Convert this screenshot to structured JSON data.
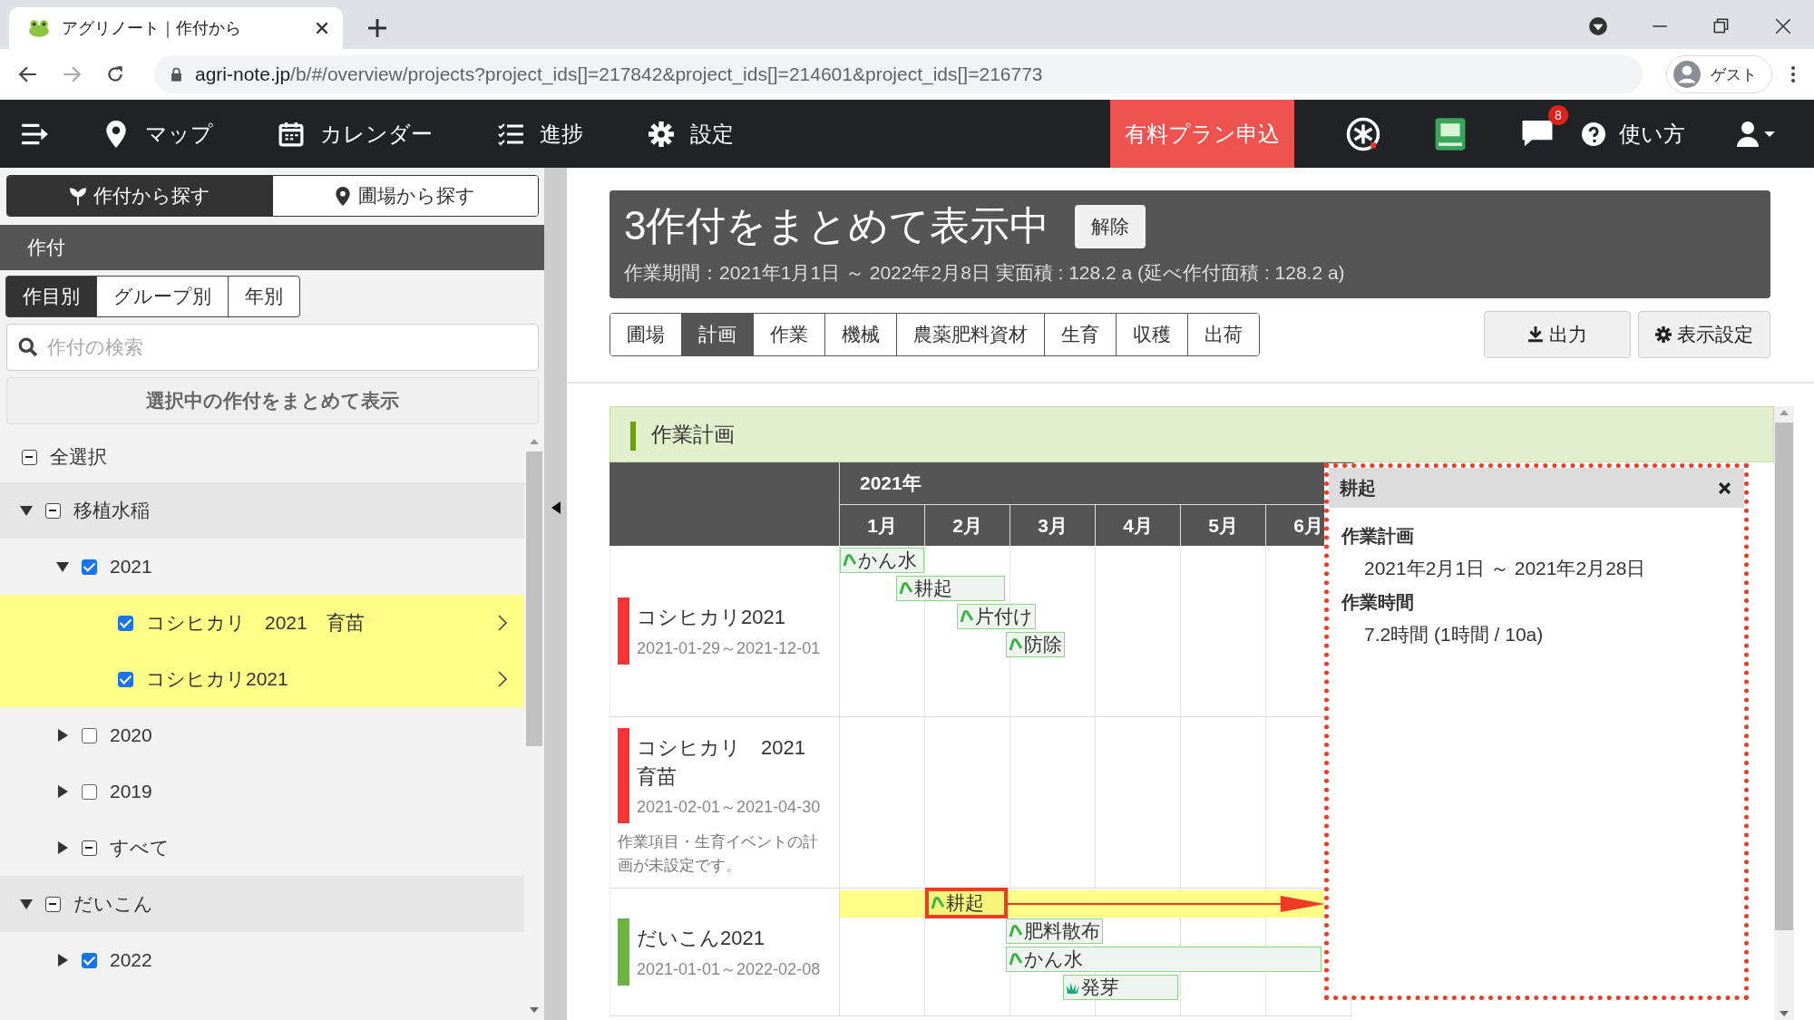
{
  "browser": {
    "tab_title": "アグリノート｜作付から",
    "url_host": "agri-note.jp",
    "url_path": "/b/#/overview/projects?project_ids[]=217842&project_ids[]=214601&project_ids[]=216773",
    "profile": "ゲスト"
  },
  "nav": {
    "items": [
      {
        "kind": "map",
        "label": "マップ"
      },
      {
        "kind": "calendar",
        "label": "カレンダー"
      },
      {
        "kind": "progress",
        "label": "進捗"
      },
      {
        "kind": "settings",
        "label": "設定"
      }
    ],
    "plan_button": "有料プラン申込",
    "notification_count": "8",
    "help_label": "使い方"
  },
  "sidebar": {
    "search_modes": [
      {
        "kind": "crop",
        "label": "作付から探す",
        "selected": true
      },
      {
        "kind": "field",
        "label": "圃場から探す",
        "selected": false
      }
    ],
    "section_title": "作付",
    "view_tabs": [
      {
        "label": "作目別",
        "selected": true
      },
      {
        "label": "グループ別",
        "selected": false
      },
      {
        "label": "年別",
        "selected": false
      }
    ],
    "search_placeholder": "作付の検索",
    "summarize_button": "選択中の作付をまとめて表示",
    "select_all": {
      "label": "全選択",
      "checked": true,
      "mixed": true
    },
    "tree": [
      {
        "kind": "group",
        "label": "移植水稲",
        "expanded": true,
        "checked": true,
        "mixed": true,
        "children": [
          {
            "kind": "year",
            "label": "2021",
            "expanded": true,
            "checked": true,
            "mixed": false,
            "children": [
              {
                "kind": "crop",
                "label": "コシヒカリ　2021　育苗",
                "checked": true,
                "mixed": false,
                "selected": true
              },
              {
                "kind": "crop",
                "label": "コシヒカリ2021",
                "checked": true,
                "mixed": false,
                "selected": true
              }
            ]
          },
          {
            "kind": "year",
            "label": "2020",
            "expanded": false,
            "checked": false,
            "mixed": false
          },
          {
            "kind": "year",
            "label": "2019",
            "expanded": false,
            "checked": false,
            "mixed": false
          },
          {
            "kind": "year",
            "label": "すべて",
            "expanded": false,
            "checked": true,
            "mixed": true
          }
        ]
      },
      {
        "kind": "group",
        "label": "だいこん",
        "expanded": true,
        "checked": true,
        "mixed": true,
        "children": [
          {
            "kind": "year",
            "label": "2022",
            "expanded": false,
            "checked": true,
            "mixed": false
          }
        ]
      }
    ]
  },
  "header": {
    "title": "3作付をまとめて表示中",
    "release_button": "解除",
    "summary": "作業期間：2021年1月1日 ～ 2022年2月8日  実面積 : 128.2 a (延べ作付面積 : 128.2 a)"
  },
  "tabs": [
    {
      "label": "圃場",
      "selected": false
    },
    {
      "label": "計画",
      "selected": true
    },
    {
      "label": "作業",
      "selected": false
    },
    {
      "label": "機械",
      "selected": false
    },
    {
      "label": "農薬肥料資材",
      "selected": false
    },
    {
      "label": "生育",
      "selected": false
    },
    {
      "label": "収穫",
      "selected": false
    },
    {
      "label": "出荷",
      "selected": false
    }
  ],
  "export_button": "出力",
  "display_settings_button": "表示設定",
  "plan": {
    "title": "作業計画",
    "year_label": "2021年",
    "months": [
      "1月",
      "2月",
      "3月",
      "4月",
      "5月",
      "6月"
    ],
    "rows": [
      {
        "name": "コシヒカリ2021",
        "period": "2021-01-29～2021-12-01",
        "color": "#ff3333",
        "tasks": [
          {
            "kind": "sprout",
            "label": "かん水",
            "highlighted": false
          },
          {
            "kind": "sprout",
            "label": "耕起",
            "highlighted": false
          },
          {
            "kind": "sprout",
            "label": "片付け",
            "highlighted": false
          },
          {
            "kind": "sprout",
            "label": "防除",
            "highlighted": false
          }
        ]
      },
      {
        "name": "コシヒカリ　2021　育苗",
        "period": "2021-02-01～2021-04-30",
        "color": "#ff3333",
        "note": "作業項目・生育イベントの計画が未設定です。"
      },
      {
        "name": "だいこん2021",
        "period": "2021-01-01～2022-02-08",
        "color": "#6db33f",
        "tasks": [
          {
            "kind": "sprout",
            "label": "耕起",
            "highlighted": true
          },
          {
            "kind": "sprout",
            "label": "肥料散布",
            "highlighted": false
          },
          {
            "kind": "sprout",
            "label": "かん水",
            "highlighted": false
          },
          {
            "kind": "grass",
            "label": "発芽",
            "highlighted": false
          }
        ]
      }
    ]
  },
  "popup": {
    "title": "耕起",
    "sections": [
      {
        "heading": "作業計画",
        "value": "2021年2月1日 ～ 2021年2月28日"
      },
      {
        "heading": "作業時間",
        "value": "7.2時間 (1時間 / 10a)"
      }
    ]
  }
}
